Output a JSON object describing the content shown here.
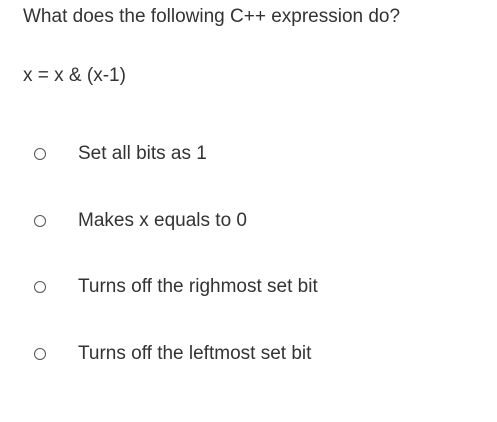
{
  "question": {
    "text": "What does the following C++ expression do?",
    "code": "x = x & (x-1)"
  },
  "options": [
    {
      "label": "Set all bits as 1",
      "selected": false
    },
    {
      "label": "Makes x equals to 0",
      "selected": false
    },
    {
      "label": "Turns off the righmost set bit",
      "selected": false
    },
    {
      "label": "Turns off the leftmost set bit",
      "selected": false
    }
  ],
  "colors": {
    "text": "#333333",
    "radio_border": "#555555",
    "background": "#ffffff"
  }
}
